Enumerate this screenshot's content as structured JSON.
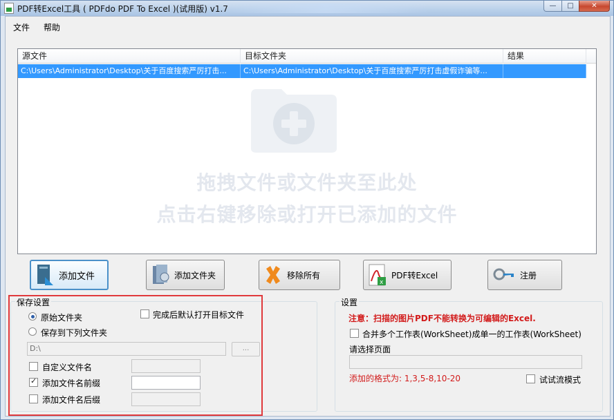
{
  "window": {
    "title": "PDF转Excel工具 ( PDFdo PDF To Excel )(试用版) v1.7"
  },
  "menu": [
    "文件",
    "帮助"
  ],
  "list": {
    "columns": [
      "源文件",
      "目标文件夹",
      "结果"
    ],
    "rows": [
      {
        "source": "C:\\Users\\Administrator\\Desktop\\关于百度搜索严厉打击...",
        "target": "C:\\Users\\Administrator\\Desktop\\关于百度搜索严厉打击虚假诈骗等...",
        "result": ""
      }
    ],
    "hint_line1": "拖拽文件或文件夹至此处",
    "hint_line2": "点击右键移除或打开已添加的文件"
  },
  "toolbar": {
    "add_file": "添加文件",
    "add_folder": "添加文件夹",
    "remove_all": "移除所有",
    "convert": "PDF转Excel",
    "register": "注册"
  },
  "save_settings": {
    "title": "保存设置",
    "radio_original": "原始文件夹",
    "radio_custom": "保存到下列文件夹",
    "open_after": "完成后默认打开目标文件",
    "folder_path": "D:\\",
    "browse_label": "...",
    "custom_name": "自定义文件名",
    "add_prefix": "添加文件名前缀",
    "add_suffix": "添加文件名后缀",
    "selected_radio": "original",
    "add_prefix_checked": true
  },
  "settings": {
    "title": "设置",
    "notice": "注意：扫描的图片PDF不能转换为可编辑的Excel.",
    "merge_label": "合并多个工作表(WorkSheet)成单一的工作表(WorkSheet)",
    "page_label": "请选择页面",
    "page_value": "",
    "format_hint": "添加的格式为: 1,3,5-8,10-20",
    "trial_mode": "试试流模式"
  },
  "colors": {
    "selection": "#3399ff",
    "highlight_box": "#e0393b",
    "notice_red": "#d21b1b"
  }
}
